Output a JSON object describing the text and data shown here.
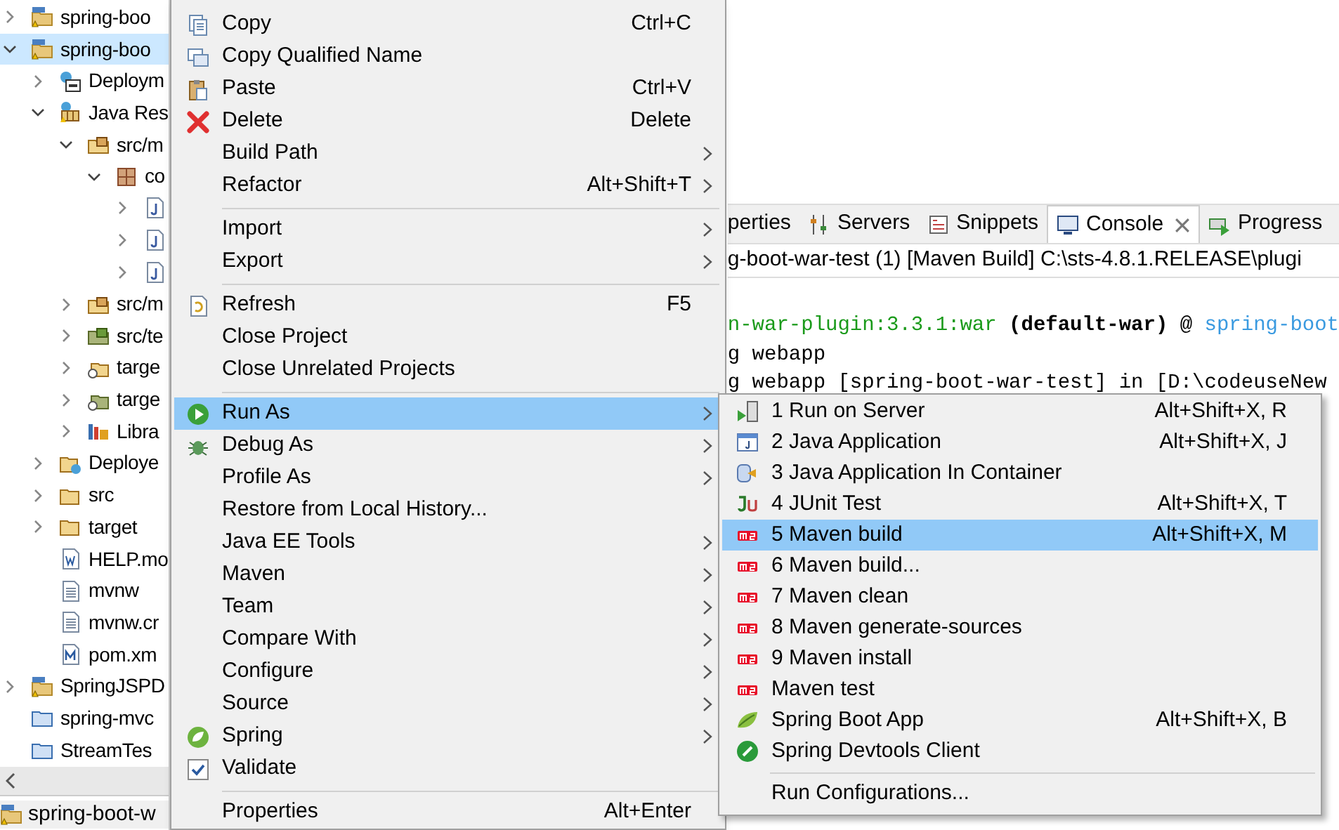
{
  "project_tree": {
    "nodes": [
      {
        "label": "spring-boo",
        "kind": "project",
        "expanded": false,
        "selected": false
      },
      {
        "label": "spring-boo",
        "kind": "project",
        "expanded": true,
        "selected": true,
        "children": [
          {
            "label": "Deploym",
            "kind": "descriptor",
            "expanded": false,
            "selected": false
          },
          {
            "label": "Java Res",
            "kind": "resources",
            "expanded": true,
            "selected": false,
            "children": [
              {
                "label": "src/m",
                "kind": "srcfolder",
                "expanded": true,
                "selected": false,
                "children": [
                  {
                    "label": "co",
                    "kind": "package",
                    "expanded": true,
                    "selected": false,
                    "children": [
                      {
                        "kind": "javafile",
                        "expanded": false,
                        "selected": false
                      },
                      {
                        "kind": "javafile",
                        "expanded": false,
                        "selected": false
                      },
                      {
                        "kind": "javafile",
                        "expanded": false,
                        "selected": false
                      }
                    ]
                  }
                ]
              },
              {
                "label": "src/m",
                "kind": "srcfolder",
                "expanded": false,
                "selected": false
              },
              {
                "label": "src/te",
                "kind": "testfolder",
                "expanded": false,
                "selected": false
              },
              {
                "label": "targe",
                "kind": "targetfolder",
                "expanded": false,
                "selected": false
              },
              {
                "label": "targe",
                "kind": "targettest",
                "expanded": false,
                "selected": false
              },
              {
                "label": "Libra",
                "kind": "library",
                "expanded": false,
                "selected": false
              }
            ]
          },
          {
            "label": "Deploye",
            "kind": "deployed",
            "expanded": false,
            "selected": false
          },
          {
            "label": "src",
            "kind": "folder",
            "expanded": false,
            "selected": false
          },
          {
            "label": "target",
            "kind": "folder",
            "expanded": false,
            "selected": false
          },
          {
            "label": "HELP.mo",
            "kind": "docfile",
            "selected": false
          },
          {
            "label": "mvnw",
            "kind": "textfile",
            "selected": false
          },
          {
            "label": "mvnw.cr",
            "kind": "textfile",
            "selected": false
          },
          {
            "label": "pom.xm",
            "kind": "mavenfile",
            "selected": false
          }
        ]
      },
      {
        "label": "SpringJSPD",
        "kind": "project",
        "expanded": false,
        "selected": false
      },
      {
        "label": "spring-mvc",
        "kind": "closedproject",
        "selected": false
      },
      {
        "label": "StreamTes",
        "kind": "closedproject",
        "selected": false
      }
    ]
  },
  "bottom_bar": {
    "label": "spring-boot-w"
  },
  "view_tabs": [
    {
      "label": "perties",
      "selected": false
    },
    {
      "label": "Servers",
      "selected": false
    },
    {
      "label": "Snippets",
      "selected": false
    },
    {
      "label": "Console",
      "selected": true
    },
    {
      "label": "Progress",
      "selected": false
    }
  ],
  "console": {
    "header": "g-boot-war-test (1) [Maven Build] C:\\sts-4.8.1.RELEASE\\plugi",
    "lines": [
      [
        {
          "text": "n-war-plugin:3.3.1:war",
          "kind": "plugin"
        },
        {
          "text": " (default-war)",
          "kind": "bold"
        },
        {
          "text": " @ ",
          "kind": "plain"
        },
        {
          "text": "spring-boot",
          "kind": "project"
        }
      ],
      [
        {
          "text": "g webapp",
          "kind": "plain"
        }
      ],
      [
        {
          "text": "g webapp [spring-boot-war-test] in [D:\\codeuseNew",
          "kind": "plain"
        }
      ]
    ]
  },
  "context_menu": {
    "items": [
      {
        "kind": "item",
        "label": "Copy",
        "shortcut": "Ctrl+C",
        "submenu": false,
        "selected": false
      },
      {
        "kind": "item",
        "label": "Copy Qualified Name",
        "submenu": false,
        "selected": false
      },
      {
        "kind": "item",
        "label": "Paste",
        "shortcut": "Ctrl+V",
        "submenu": false,
        "selected": false
      },
      {
        "kind": "item",
        "label": "Delete",
        "shortcut": "Delete",
        "submenu": false,
        "selected": false
      },
      {
        "kind": "item",
        "label": "Build Path",
        "submenu": true,
        "selected": false
      },
      {
        "kind": "item",
        "label": "Refactor",
        "shortcut": "Alt+Shift+T",
        "submenu": true,
        "selected": false
      },
      {
        "kind": "separator"
      },
      {
        "kind": "item",
        "label": "Import",
        "submenu": true,
        "selected": false
      },
      {
        "kind": "item",
        "label": "Export",
        "submenu": true,
        "selected": false
      },
      {
        "kind": "separator"
      },
      {
        "kind": "item",
        "label": "Refresh",
        "shortcut": "F5",
        "submenu": false,
        "selected": false
      },
      {
        "kind": "item",
        "label": "Close Project",
        "submenu": false,
        "selected": false
      },
      {
        "kind": "item",
        "label": "Close Unrelated Projects",
        "submenu": false,
        "selected": false
      },
      {
        "kind": "separator"
      },
      {
        "kind": "item",
        "label": "Run As",
        "submenu": true,
        "selected": true
      },
      {
        "kind": "item",
        "label": "Debug As",
        "submenu": true,
        "selected": false
      },
      {
        "kind": "item",
        "label": "Profile As",
        "submenu": true,
        "selected": false
      },
      {
        "kind": "item",
        "label": "Restore from Local History...",
        "submenu": false,
        "selected": false
      },
      {
        "kind": "item",
        "label": "Java EE Tools",
        "submenu": true,
        "selected": false
      },
      {
        "kind": "item",
        "label": "Maven",
        "submenu": true,
        "selected": false
      },
      {
        "kind": "item",
        "label": "Team",
        "submenu": true,
        "selected": false
      },
      {
        "kind": "item",
        "label": "Compare With",
        "submenu": true,
        "selected": false
      },
      {
        "kind": "item",
        "label": "Configure",
        "submenu": true,
        "selected": false
      },
      {
        "kind": "item",
        "label": "Source",
        "submenu": true,
        "selected": false
      },
      {
        "kind": "item",
        "label": "Spring",
        "submenu": true,
        "selected": false
      },
      {
        "kind": "item",
        "label": "Validate",
        "submenu": false,
        "selected": false
      },
      {
        "kind": "separator"
      },
      {
        "kind": "item",
        "label": "Properties",
        "shortcut": "Alt+Enter",
        "submenu": false,
        "selected": false
      }
    ]
  },
  "run_as_submenu": {
    "items": [
      {
        "kind": "item",
        "label": "1 Run on Server",
        "shortcut": "Alt+Shift+X, R",
        "selected": false
      },
      {
        "kind": "item",
        "label": "2 Java Application",
        "shortcut": "Alt+Shift+X, J",
        "selected": false
      },
      {
        "kind": "item",
        "label": "3 Java Application In Container",
        "selected": false
      },
      {
        "kind": "item",
        "label": "4 JUnit Test",
        "shortcut": "Alt+Shift+X, T",
        "selected": false
      },
      {
        "kind": "item",
        "label": "5 Maven build",
        "shortcut": "Alt+Shift+X, M",
        "selected": true
      },
      {
        "kind": "item",
        "label": "6 Maven build...",
        "selected": false
      },
      {
        "kind": "item",
        "label": "7 Maven clean",
        "selected": false
      },
      {
        "kind": "item",
        "label": "8 Maven generate-sources",
        "selected": false
      },
      {
        "kind": "item",
        "label": "9 Maven install",
        "selected": false
      },
      {
        "kind": "item",
        "label": "Maven test",
        "selected": false
      },
      {
        "kind": "item",
        "label": "Spring Boot App",
        "shortcut": "Alt+Shift+X, B",
        "selected": false
      },
      {
        "kind": "item",
        "label": "Spring Devtools Client",
        "selected": false
      },
      {
        "kind": "separator"
      },
      {
        "kind": "item",
        "label": "Run Configurations...",
        "selected": false
      }
    ]
  }
}
